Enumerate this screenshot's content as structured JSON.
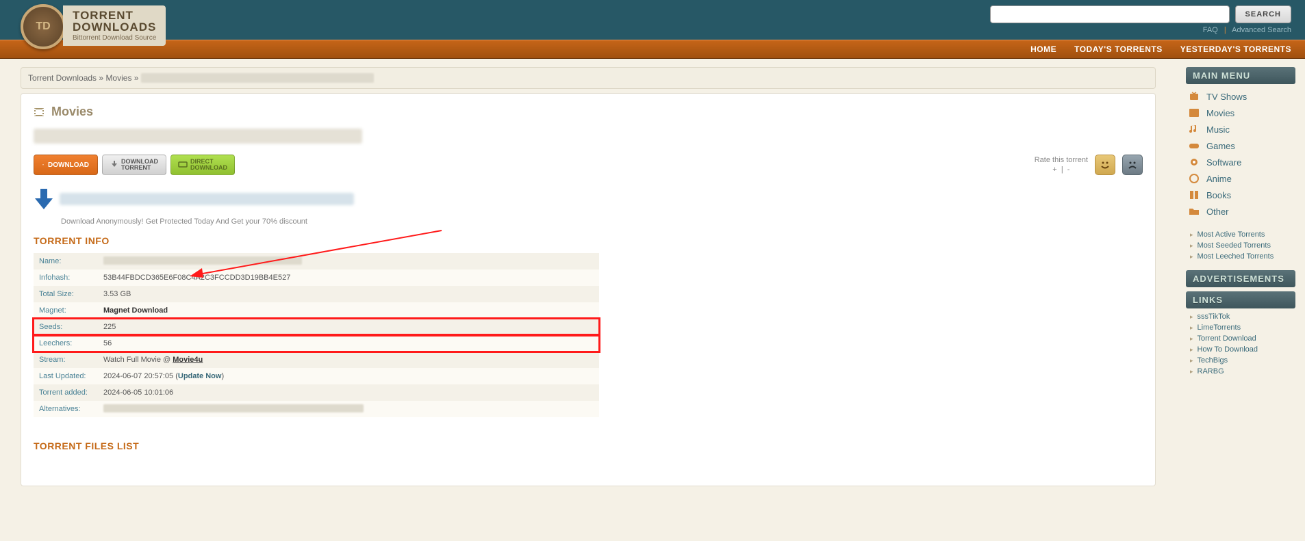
{
  "header": {
    "logo_line1": "TORRENT",
    "logo_line2": "DOWNLOADS",
    "logo_sub": "Bittorrent Download Source",
    "logo_badge": "TD",
    "search_placeholder": "",
    "search_button": "SEARCH",
    "faq": "FAQ",
    "advanced": "Advanced Search"
  },
  "nav": {
    "home": "HOME",
    "today": "TODAY'S TORRENTS",
    "yesterday": "YESTERDAY'S TORRENTS"
  },
  "breadcrumb": {
    "root": "Torrent Downloads",
    "sep": "»",
    "cat": "Movies"
  },
  "content": {
    "category_heading": "Movies",
    "btn_download": "DOWNLOAD",
    "btn_dl_torrent_1": "DOWNLOAD",
    "btn_dl_torrent_2": "TORRENT",
    "btn_direct_1": "DIRECT",
    "btn_direct_2": "DOWNLOAD",
    "rate_label": "Rate this torrent",
    "rate_plus": "+",
    "rate_sep": "|",
    "rate_minus": "-",
    "anon_sub": "Download Anonymously! Get Protected Today And Get your 70% discount",
    "torrent_info_title": "TORRENT INFO",
    "info": {
      "name_label": "Name:",
      "name_value": "",
      "hash_label": "Infohash:",
      "hash_value": "53B44FBDCD365E6F08C4A2C3FCCDD3D19BB4E527",
      "size_label": "Total Size:",
      "size_value": "3.53 GB",
      "magnet_label": "Magnet:",
      "magnet_value": "Magnet Download",
      "seeds_label": "Seeds:",
      "seeds_value": "225",
      "leech_label": "Leechers:",
      "leech_value": "56",
      "stream_label": "Stream:",
      "stream_prefix": "Watch Full Movie @ ",
      "stream_link": "Movie4u",
      "updated_label": "Last Updated:",
      "updated_value": "2024-06-07 20:57:05 (",
      "update_now": "Update Now",
      "updated_suffix": ")",
      "added_label": "Torrent added:",
      "added_value": "2024-06-05 10:01:06",
      "alt_label": "Alternatives:",
      "alt_value": ""
    },
    "files_list_title": "TORRENT FILES LIST"
  },
  "sidebar": {
    "main_menu": "MAIN MENU",
    "categories": [
      {
        "icon": "tv",
        "label": "TV Shows"
      },
      {
        "icon": "film",
        "label": "Movies"
      },
      {
        "icon": "music",
        "label": "Music"
      },
      {
        "icon": "game",
        "label": "Games"
      },
      {
        "icon": "software",
        "label": "Software"
      },
      {
        "icon": "anime",
        "label": "Anime"
      },
      {
        "icon": "book",
        "label": "Books"
      },
      {
        "icon": "other",
        "label": "Other"
      }
    ],
    "sub_links": [
      "Most Active Torrents",
      "Most Seeded Torrents",
      "Most Leeched Torrents"
    ],
    "ads_title": "ADVERTISEMENTS",
    "links_title": "LINKS",
    "ext_links": [
      "sssTikTok",
      "LimeTorrents",
      "Torrent Download",
      "How To Download",
      "TechBigs",
      "RARBG"
    ]
  }
}
